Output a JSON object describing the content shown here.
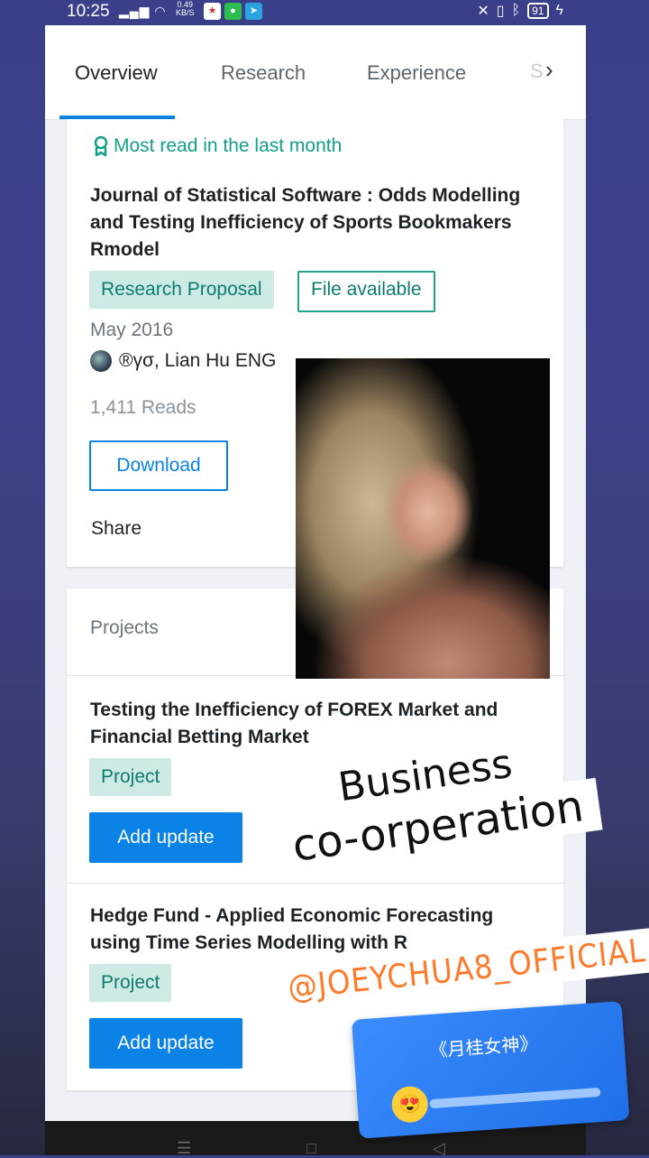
{
  "status_bar": {
    "time": "10:25",
    "net_speed_value": "0.49",
    "net_speed_unit": "KB/S",
    "battery": "91"
  },
  "tabs": {
    "items": [
      "Overview",
      "Research",
      "Experience",
      "S"
    ],
    "active": "Overview"
  },
  "publication": {
    "badge": "Most read in the last month",
    "title": "Journal of Statistical Software : Odds Modelling and Testing Inefficiency of Sports Bookmakers Rmodel",
    "type_tag": "Research Proposal",
    "file_tag": "File available",
    "date": "May 2016",
    "authors": "®γσ, Lian Hu ENG",
    "reads": "1,411 Reads",
    "download_label": "Download",
    "share_label": "Share"
  },
  "projects": {
    "heading": "Projects",
    "items": [
      {
        "title": "Testing the Inefficiency of FOREX Market and Financial Betting Market",
        "tag": "Project",
        "button": "Add update"
      },
      {
        "title": "Hedge Fund - Applied Economic Forecasting using Time Series Modelling with R",
        "tag": "Project",
        "button": "Add update"
      }
    ]
  },
  "overlay": {
    "sticker_line1": "Business",
    "sticker_line2": "co-orperation",
    "handle": "@JOEYCHUA8_OFFICIAL",
    "music_title": "《月桂女神》",
    "music_emoji": "😍"
  },
  "colors": {
    "accent_blue": "#0a82e6",
    "teal": "#13a08a",
    "handle_orange": "#ff7a2a"
  }
}
